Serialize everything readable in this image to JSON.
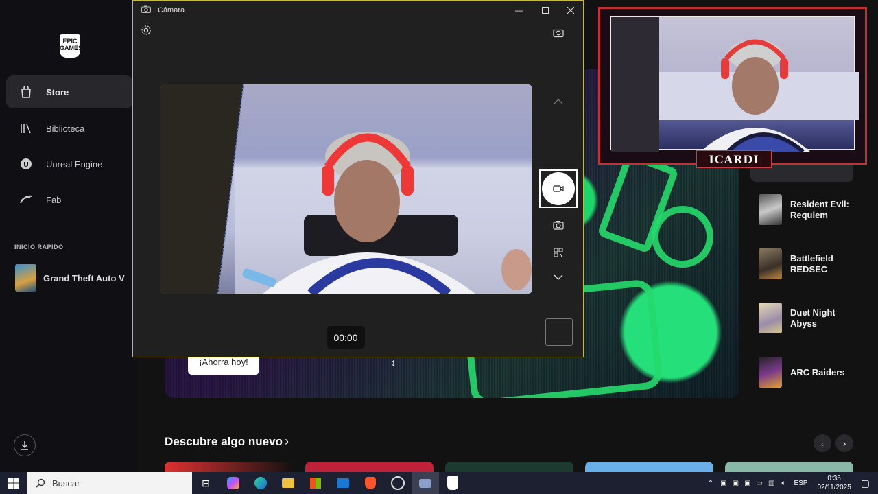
{
  "epic": {
    "logo_text": "EPIC GAMES",
    "nav": [
      {
        "label": "Store",
        "active": true
      },
      {
        "label": "Biblioteca"
      },
      {
        "label": "Unreal Engine"
      },
      {
        "label": "Fab"
      }
    ],
    "quick_start_title": "INICIO RÁPIDO",
    "quick_start_game": "Grand Theft Auto V",
    "promo_button": "¡Ahorra hoy!",
    "discover_title": "Descubre algo nuevo",
    "right_list": [
      {
        "label": "Resident Evil: Requiem"
      },
      {
        "label": "Battlefield REDSEC"
      },
      {
        "label": "Duet Night Abyss"
      },
      {
        "label": "ARC Raiders"
      }
    ]
  },
  "camera": {
    "title": "Cámara",
    "timer": "00:00"
  },
  "overlay": {
    "name": "ICARDI"
  },
  "taskbar": {
    "search_placeholder": "Buscar",
    "language": "ESP",
    "time": "0:35",
    "date": "02/11/2025"
  },
  "colors": {
    "camera_border": "#c8b83a",
    "overlay_red": "#c53034",
    "hero_green": "#26d96c"
  }
}
